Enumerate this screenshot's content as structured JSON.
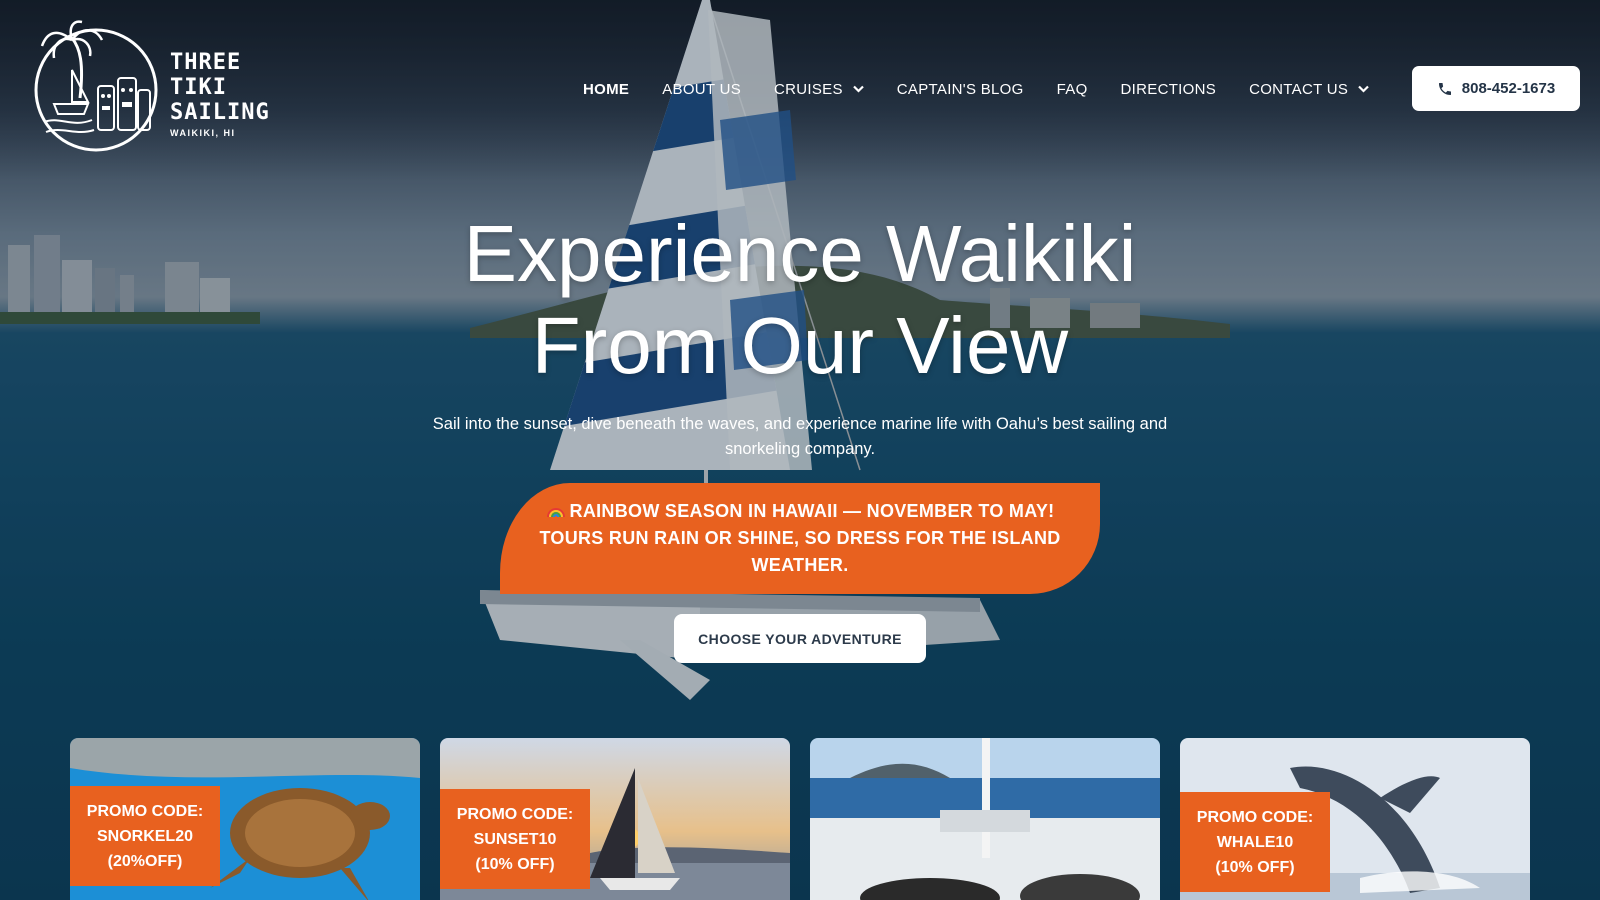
{
  "brand": {
    "name_lines": [
      "THREE",
      "TIKI",
      "SAILING"
    ],
    "locale": "WAIKIKI, HI"
  },
  "nav": {
    "items": [
      {
        "label": "HOME",
        "active": true,
        "dropdown": false
      },
      {
        "label": "ABOUT US",
        "active": false,
        "dropdown": false
      },
      {
        "label": "CRUISES",
        "active": false,
        "dropdown": true
      },
      {
        "label": "CAPTAIN'S BLOG",
        "active": false,
        "dropdown": false
      },
      {
        "label": "FAQ",
        "active": false,
        "dropdown": false
      },
      {
        "label": "DIRECTIONS",
        "active": false,
        "dropdown": false
      },
      {
        "label": "CONTACT US",
        "active": false,
        "dropdown": true
      }
    ],
    "phone": "808-452-1673",
    "phone_icon": "phone-icon"
  },
  "hero": {
    "title_line1": "Experience Waikiki",
    "title_line2": "From Our View",
    "subtitle": "Sail into the sunset, dive beneath the waves, and experience marine life with Oahu’s best sailing and snorkeling company.",
    "notice": "RAINBOW SEASON IN HAWAII — NOVEMBER TO MAY! TOURS RUN RAIN OR SHINE, SO DRESS FOR THE ISLAND WEATHER.",
    "notice_icon": "rainbow-icon",
    "cta": "CHOOSE YOUR ADVENTURE"
  },
  "cards": [
    {
      "promo_line1": "PROMO CODE:",
      "promo_line2": "SNORKEL20",
      "promo_line3": "(20%OFF)",
      "scene": "sea-turtle"
    },
    {
      "promo_line1": "PROMO CODE:",
      "promo_line2": "SUNSET10",
      "promo_line3": "(10% OFF)",
      "scene": "sunset-sail"
    },
    {
      "promo_line1": "",
      "promo_line2": "",
      "promo_line3": "",
      "scene": "catamaran-deck"
    },
    {
      "promo_line1": "PROMO CODE:",
      "promo_line2": "WHALE10",
      "promo_line3": "(10% OFF)",
      "scene": "whale-breach"
    }
  ],
  "colors": {
    "accent_orange": "#e8611f",
    "button_text": "#243447",
    "ocean": "#17506f"
  }
}
